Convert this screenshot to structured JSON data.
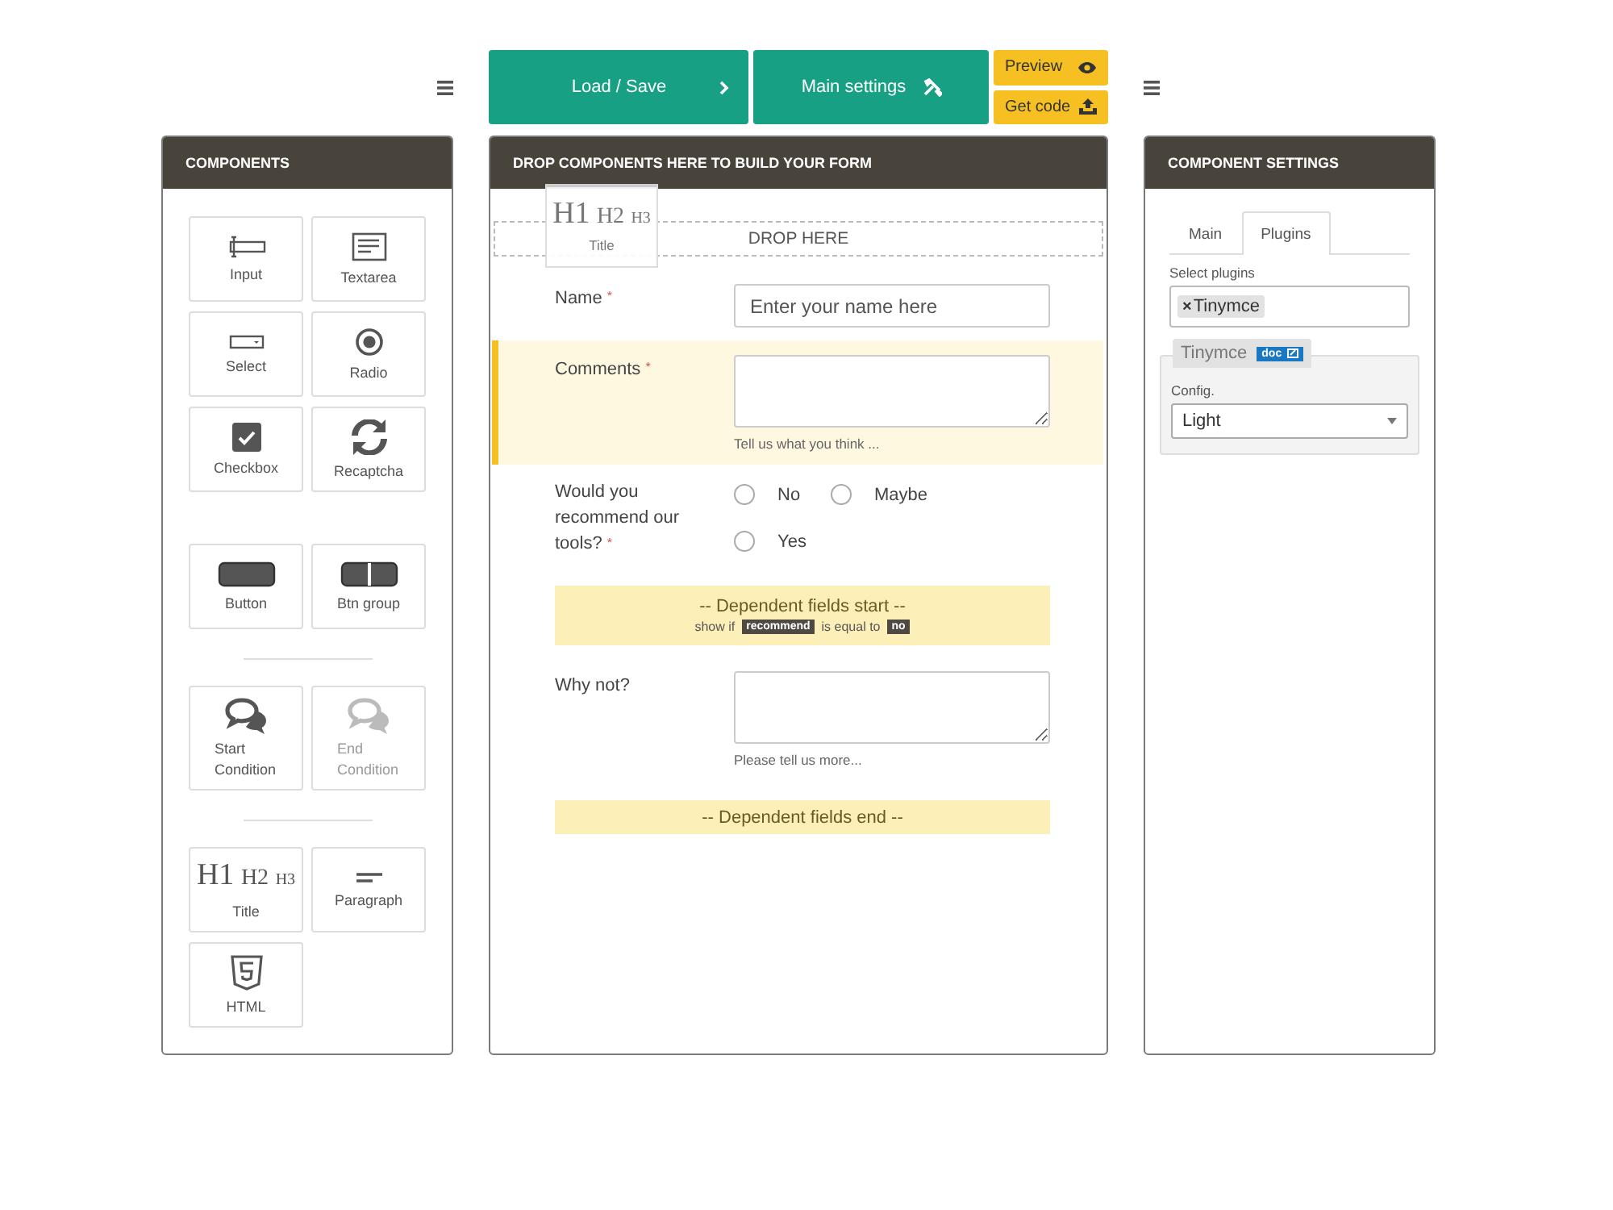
{
  "toolbar": {
    "buttons": [
      {
        "label": "Load / Save",
        "kind": "load"
      },
      {
        "label": "Main settings",
        "kind": "settings"
      }
    ],
    "small_buttons": [
      {
        "label": "Preview",
        "kind": "preview"
      },
      {
        "label": "Get code",
        "kind": "code"
      }
    ]
  },
  "components": {
    "title": "COMPONENTS",
    "groups": [
      [
        {
          "label": "Input",
          "kind": "input",
          "disabled": false
        },
        {
          "label": "Textarea",
          "kind": "textarea",
          "disabled": false
        },
        {
          "label": "Select",
          "kind": "select",
          "disabled": false
        },
        {
          "label": "Radio",
          "kind": "radio",
          "disabled": false
        },
        {
          "label": "Checkbox",
          "kind": "checkbox",
          "disabled": false
        },
        {
          "label": "Recaptcha",
          "kind": "recaptcha",
          "disabled": false
        }
      ],
      [
        {
          "label": "Button",
          "kind": "button",
          "disabled": false
        },
        {
          "label": "Btn group",
          "kind": "btngroup",
          "disabled": false
        }
      ],
      [
        {
          "label": "Start Condition",
          "kind": "condition",
          "disabled": false
        },
        {
          "label": "End Condition",
          "kind": "condition",
          "disabled": true
        }
      ],
      [
        {
          "label": "Title",
          "kind": "title",
          "glyph": "H1 H2 H3",
          "disabled": false
        },
        {
          "label": "Paragraph",
          "kind": "paragraph",
          "disabled": false
        },
        {
          "label": "HTML",
          "kind": "html",
          "disabled": false
        }
      ]
    ]
  },
  "canvas": {
    "title": "DROP COMPONENTS HERE TO BUILD YOUR FORM",
    "drop_zone": "DROP HERE",
    "dragged": {
      "glyph": "H1 H2 H3",
      "label": "Title"
    },
    "fields": [
      {
        "kind": "text",
        "label": "Name",
        "required_mark": "*",
        "placeholder": "Enter your name here",
        "selected": false
      },
      {
        "kind": "textarea",
        "label": "Comments",
        "required_mark": "*",
        "help": "Tell us what you think ...",
        "selected": true
      },
      {
        "kind": "radio",
        "label": "Would you recommend our tools?",
        "required_mark": "*",
        "options": [
          {
            "label": "No",
            "selected": false
          },
          {
            "label": "Maybe",
            "selected": false
          },
          {
            "label": "Yes",
            "selected": false
          }
        ],
        "selected": false
      },
      {
        "kind": "condition_start",
        "label": "-- Dependent fields start --",
        "rule": [
          "show if",
          "recommend",
          "is equal to",
          "no"
        ],
        "selected": false
      },
      {
        "kind": "textarea",
        "label": "Why not?",
        "help": "Please tell us more...",
        "selected": false
      },
      {
        "kind": "condition_end",
        "label": "-- Dependent fields end --",
        "selected": false
      }
    ]
  },
  "settings": {
    "title": "COMPONENT SETTINGS",
    "tabs": [
      {
        "label": "Main",
        "selected": false
      },
      {
        "label": "Plugins",
        "selected": true
      }
    ],
    "plugins_label": "Select plugins",
    "plugin_tags": [
      {
        "remove": "×",
        "label": "Tinymce"
      }
    ],
    "plugin_panel": {
      "title": "Tinymce",
      "badge": "doc",
      "config_label": "Config.",
      "config_value": "Light"
    }
  }
}
